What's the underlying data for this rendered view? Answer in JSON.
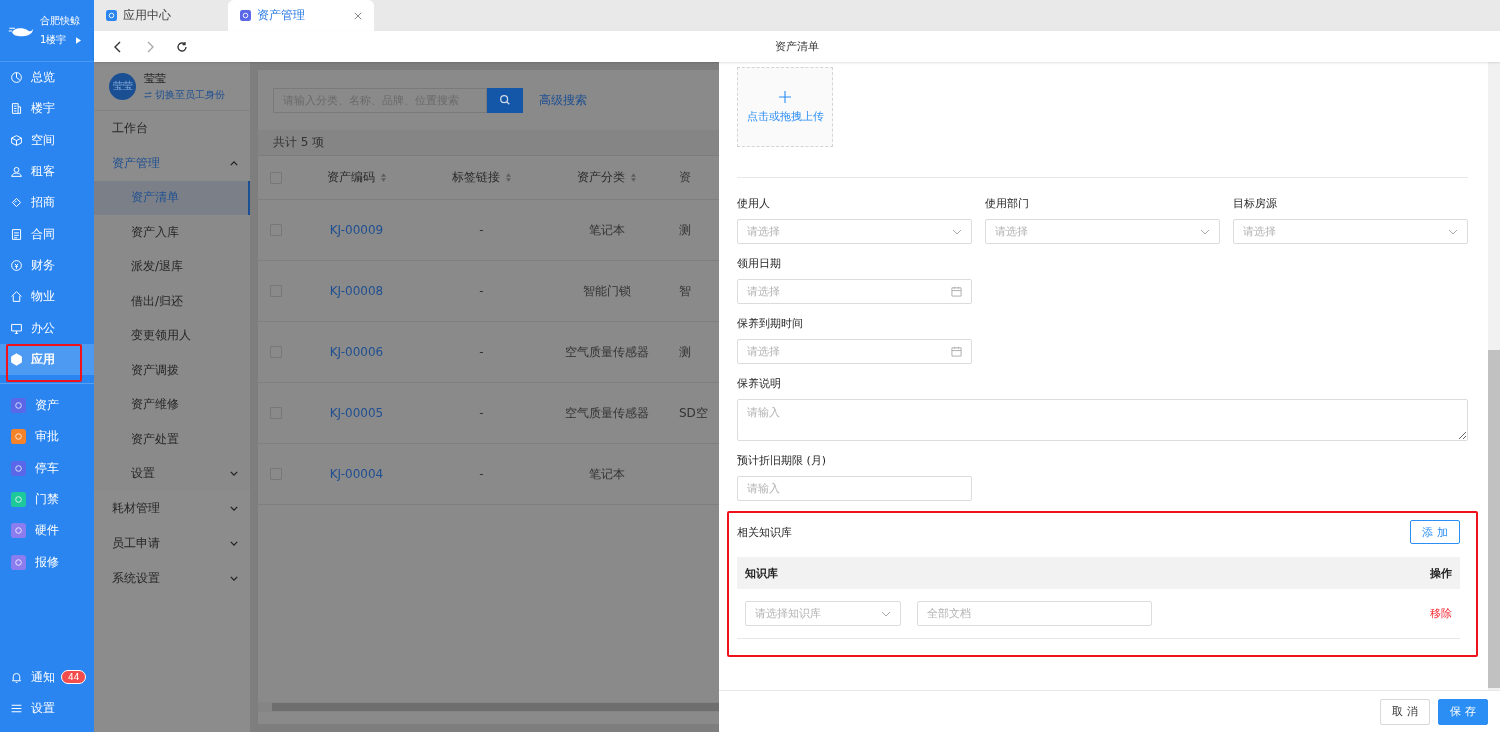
{
  "brand": {
    "company": "合肥快鲸",
    "building": "1楼宇"
  },
  "nav": [
    {
      "label": "总览",
      "selected": false
    },
    {
      "label": "楼宇",
      "selected": false
    },
    {
      "label": "空间",
      "selected": false
    },
    {
      "label": "租客",
      "selected": false
    },
    {
      "label": "招商",
      "selected": false
    },
    {
      "label": "合同",
      "selected": false
    },
    {
      "label": "财务",
      "selected": false
    },
    {
      "label": "物业",
      "selected": false
    },
    {
      "label": "办公",
      "selected": false
    },
    {
      "label": "应用",
      "selected": true
    }
  ],
  "apps": [
    {
      "label": "资产",
      "color": "#5a67e8"
    },
    {
      "label": "审批",
      "color": "#f5832a"
    },
    {
      "label": "停车",
      "color": "#5a67e8"
    },
    {
      "label": "门禁",
      "color": "#1dc99a"
    },
    {
      "label": "硬件",
      "color": "#8b7cf0"
    },
    {
      "label": "报修",
      "color": "#8b7cf0"
    }
  ],
  "bottom_nav": [
    {
      "label": "通知",
      "badge": "44"
    },
    {
      "label": "设置"
    }
  ],
  "tabs": [
    {
      "label": "应用中心",
      "selected": false,
      "closable": false
    },
    {
      "label": "资产管理",
      "selected": true,
      "closable": true
    }
  ],
  "page_title": "资产清单",
  "user": {
    "avatar": "莹莹",
    "name": "莹莹",
    "switch_link": "切换至员工身份"
  },
  "subnav": [
    {
      "label": "工作台",
      "selected": false
    },
    {
      "label": "资产管理",
      "selected": false,
      "expanded": true,
      "children": [
        {
          "label": "资产清单",
          "selected": true
        },
        {
          "label": "资产入库",
          "selected": false
        },
        {
          "label": "派发/退库",
          "selected": false
        },
        {
          "label": "借出/归还",
          "selected": false
        },
        {
          "label": "变更领用人",
          "selected": false
        },
        {
          "label": "资产调拨",
          "selected": false
        },
        {
          "label": "资产维修",
          "selected": false
        },
        {
          "label": "资产处置",
          "selected": false
        },
        {
          "label": "设置",
          "selected": false,
          "expanded": false
        }
      ]
    },
    {
      "label": "耗材管理",
      "selected": false,
      "expanded": false
    },
    {
      "label": "员工申请",
      "selected": false,
      "expanded": false
    },
    {
      "label": "系统设置",
      "selected": false,
      "expanded": false
    }
  ],
  "search": {
    "placeholder": "请输入分类、名称、品牌、位置搜索",
    "advanced": "高级搜索"
  },
  "total": "共计 5 项",
  "table": {
    "all_checked": false,
    "columns": [
      {
        "label": "资产编码",
        "sortable": true
      },
      {
        "label": "标签链接",
        "sortable": true
      },
      {
        "label": "资产分类",
        "sortable": true
      },
      {
        "label": "资",
        "sortable": false
      }
    ],
    "rows": [
      {
        "checked": false,
        "code": "KJ-00009",
        "tag_link": "-",
        "category": "笔记本",
        "column_4": "测"
      },
      {
        "checked": false,
        "code": "KJ-00008",
        "tag_link": "-",
        "category": "智能门锁",
        "column_4": "智"
      },
      {
        "checked": false,
        "code": "KJ-00006",
        "tag_link": "-",
        "category": "空气质量传感器",
        "column_4": "测"
      },
      {
        "checked": false,
        "code": "KJ-00005",
        "tag_link": "-",
        "category": "空气质量传感器",
        "column_4": "SD空"
      },
      {
        "checked": false,
        "code": "KJ-00004",
        "tag_link": "-",
        "category": "笔记本"
      }
    ]
  },
  "drawer": {
    "upload": {
      "label": "点击或拖拽上传"
    },
    "form_rows": [
      [
        {
          "label": "使用人",
          "kind": "select",
          "placeholder": "请选择"
        },
        {
          "label": "使用部门",
          "kind": "select",
          "placeholder": "请选择"
        },
        {
          "label": "目标房源",
          "kind": "select",
          "placeholder": "请选择"
        }
      ],
      [
        {
          "label": "领用日期",
          "kind": "date",
          "placeholder": "请选择"
        }
      ],
      [
        {
          "label": "保养到期时间",
          "kind": "date",
          "placeholder": "请选择"
        }
      ],
      [
        {
          "label": "保养说明",
          "kind": "textarea",
          "placeholder": "请输入"
        }
      ],
      [
        {
          "label": "预计折旧期限 (月)",
          "kind": "input",
          "placeholder": "请输入"
        }
      ]
    ],
    "knowledge": {
      "title": "相关知识库",
      "add_button": "添 加",
      "columns": [
        "知识库",
        "操作"
      ],
      "rows": [
        {
          "base_placeholder": "请选择知识库",
          "docs_placeholder": "全部文档",
          "remove": "移除"
        }
      ]
    },
    "buttons": [
      {
        "label": "取 消",
        "kind": "default"
      },
      {
        "label": "保 存",
        "kind": "primary"
      }
    ]
  }
}
